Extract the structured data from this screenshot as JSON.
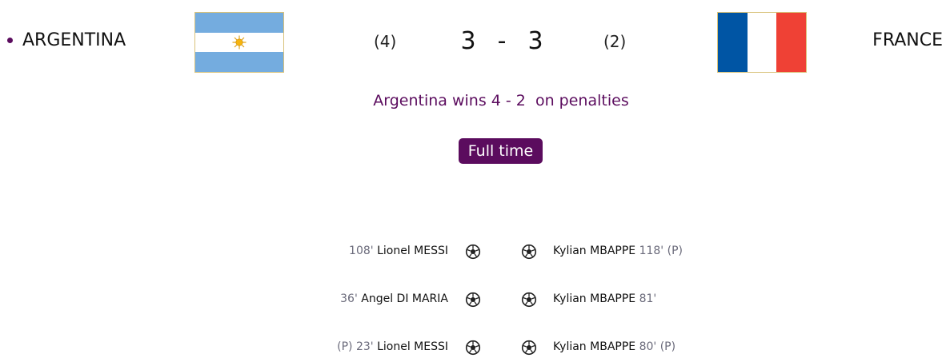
{
  "match": {
    "home": {
      "name": "ARGENTINA",
      "flag_icon": "argentina-flag-icon",
      "penalties": "(4)",
      "score": "3"
    },
    "away": {
      "name": "FRANCE",
      "flag_icon": "france-flag-icon",
      "penalties": "(2)",
      "score": "3"
    },
    "score_separator": "-",
    "result_text": "Argentina wins 4 - 2  on penalties",
    "status": "Full time"
  },
  "goals": [
    {
      "home": {
        "pen_tag": "",
        "minute": "108'",
        "player": "Lionel MESSI"
      },
      "away": {
        "player": "Kylian MBAPPE",
        "minute": "118'",
        "pen_tag": "(P)"
      }
    },
    {
      "home": {
        "pen_tag": "",
        "minute": "36'",
        "player": "Angel DI MARIA"
      },
      "away": {
        "player": "Kylian MBAPPE",
        "minute": "81'",
        "pen_tag": ""
      }
    },
    {
      "home": {
        "pen_tag": "(P)",
        "minute": "23'",
        "player": "Lionel MESSI"
      },
      "away": {
        "player": "Kylian MBAPPE",
        "minute": "80'",
        "pen_tag": "(P)"
      }
    }
  ],
  "colors": {
    "accent": "#5b0c5e",
    "argentina_blue": "#74acdf",
    "france_blue": "#0055a4",
    "france_red": "#ef4135"
  },
  "icons": {
    "goal": "soccer-ball-icon",
    "live": "live-dot-icon"
  }
}
